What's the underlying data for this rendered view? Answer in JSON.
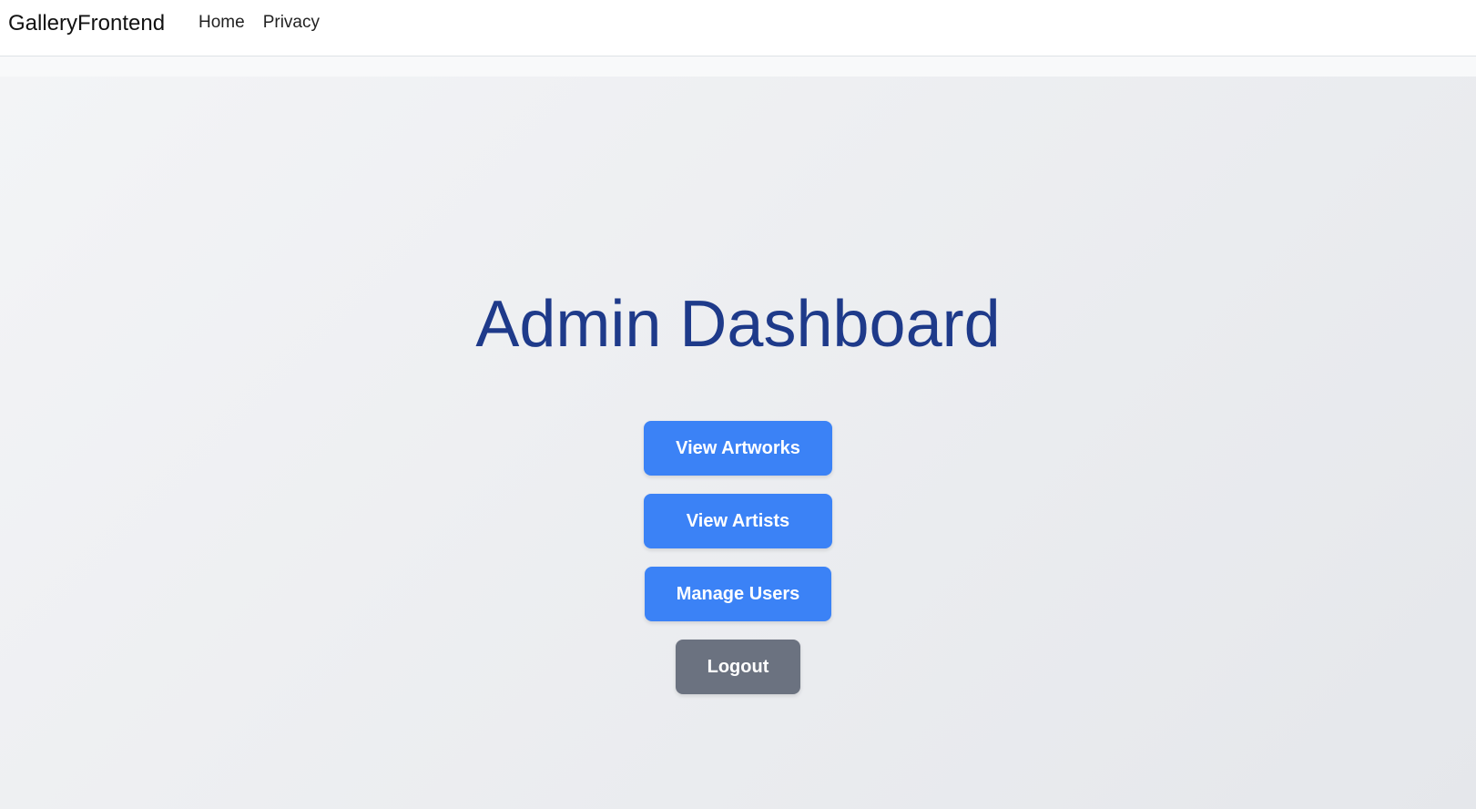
{
  "navbar": {
    "brand": "GalleryFrontend",
    "links": [
      {
        "label": "Home"
      },
      {
        "label": "Privacy"
      }
    ]
  },
  "main": {
    "title": "Admin Dashboard",
    "buttons": {
      "view_artworks": "View Artworks",
      "view_artists": "View Artists",
      "manage_users": "Manage Users",
      "logout": "Logout"
    }
  },
  "colors": {
    "primary_button": "#3b82f6",
    "secondary_button": "#6b7280",
    "title": "#1e3a8a",
    "background_start": "#f3f4f6",
    "background_end": "#e5e7eb"
  }
}
